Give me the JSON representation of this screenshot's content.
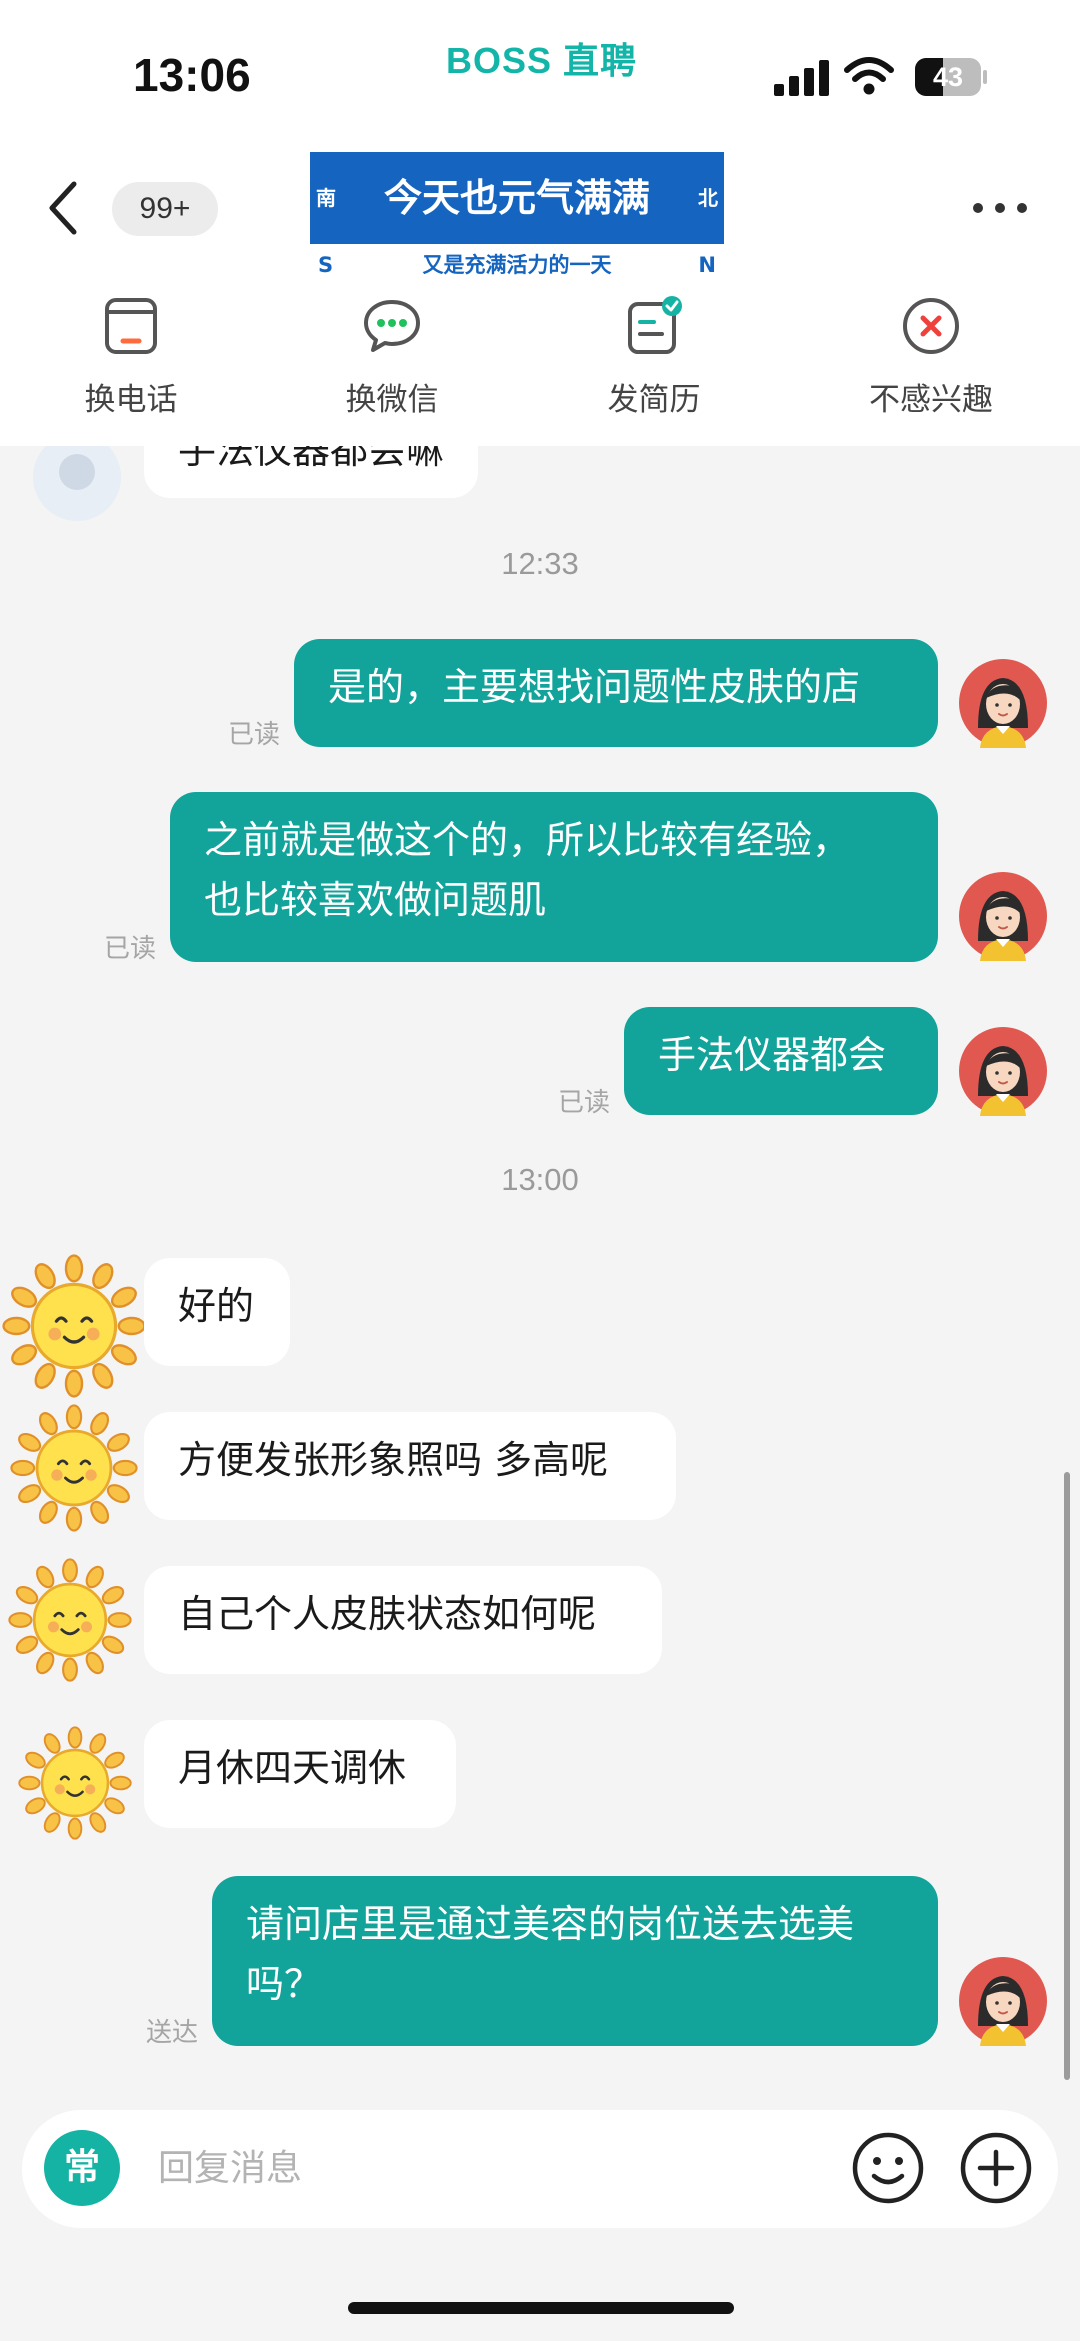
{
  "status_bar": {
    "time": "13:06",
    "brand": "BOSS 直聘",
    "battery": "43",
    "battery_fraction": 0.43
  },
  "header": {
    "unread_badge": "99+",
    "banner": {
      "left": "南",
      "right": "北",
      "title": "今天也元气满满",
      "sub_left": "S",
      "sub_right": "N",
      "subtitle": "又是充满活力的一天"
    },
    "icons": {
      "back": "chevron-left-icon",
      "more": "more-icon"
    }
  },
  "actions": [
    {
      "label": "换电话",
      "icon": "phone-icon"
    },
    {
      "label": "换微信",
      "icon": "wechat-icon"
    },
    {
      "label": "发简历",
      "icon": "resume-icon"
    },
    {
      "label": "不感兴趣",
      "icon": "not-interested-icon"
    }
  ],
  "chat": {
    "partial_message": "手法仪器都会嘛",
    "timestamps": [
      "12:33",
      "13:00"
    ],
    "messages": [
      {
        "from": "me",
        "text": "是的，主要想找问题性皮肤的店",
        "status": "已读"
      },
      {
        "from": "me",
        "text": "之前就是做这个的，所以比较有经验，也比较喜欢做问题肌",
        "line1": "之前就是做这个的，所以比较有经验，",
        "line2": "也比较喜欢做问题肌",
        "status": "已读"
      },
      {
        "from": "me",
        "text": "手法仪器都会",
        "status": "已读"
      },
      {
        "from": "them",
        "text": "好的"
      },
      {
        "from": "them",
        "text": "方便发张形象照吗 多高呢"
      },
      {
        "from": "them",
        "text": "自己个人皮肤状态如何呢"
      },
      {
        "from": "them",
        "text": "月休四天调休"
      },
      {
        "from": "me",
        "text": "请问店里是通过美容的岗位送去选美吗？",
        "line1": "请问店里是通过美容的岗位送去选美",
        "line2": "吗？",
        "status": "送达"
      }
    ]
  },
  "input": {
    "quick_label": "常",
    "placeholder": "回复消息"
  },
  "colors": {
    "brand": "#13b5a8",
    "bubble_out": "#12a39b",
    "banner": "#1565c0",
    "background": "#f4f4f4"
  }
}
